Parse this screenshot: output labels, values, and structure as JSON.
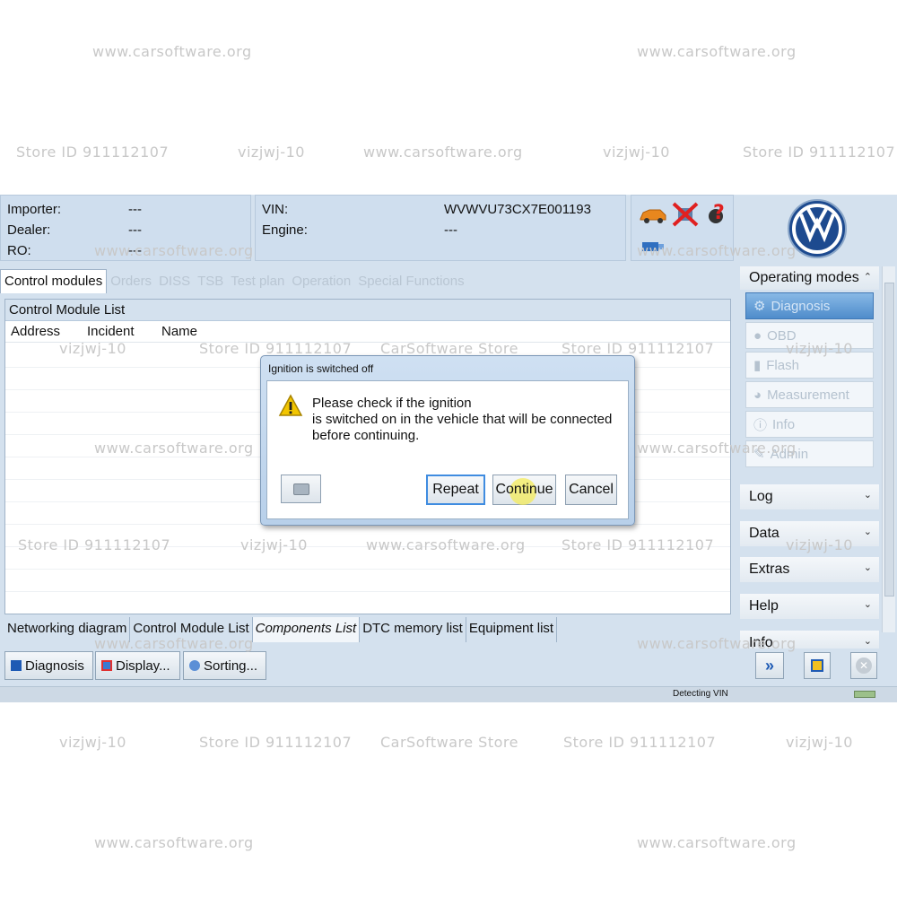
{
  "watermarks": {
    "site": "www.carsoftware.org",
    "store_id": "Store ID 911112107",
    "user": "vizjwj-10",
    "store": "CarSoftware Store"
  },
  "header": {
    "importer_label": "Importer:",
    "importer_value": "---",
    "dealer_label": "Dealer:",
    "dealer_value": "---",
    "ro_label": "RO:",
    "ro_value": "---",
    "vin_label": "VIN:",
    "vin_value": "WVWVU73CX7E001193",
    "engine_label": "Engine:",
    "engine_value": "---"
  },
  "tabs": [
    {
      "label": "Control modules",
      "active": true
    },
    {
      "label": "Orders"
    },
    {
      "label": "DISS"
    },
    {
      "label": "TSB"
    },
    {
      "label": "Test plan"
    },
    {
      "label": "Operation"
    },
    {
      "label": "Special Functions"
    }
  ],
  "control_module_list": {
    "title": "Control Module List",
    "columns": [
      "Address",
      "Incident",
      "Name"
    ]
  },
  "bottom_tabs": [
    {
      "label": "Networking diagram"
    },
    {
      "label": "Control Module List"
    },
    {
      "label": "Components List",
      "active": true
    },
    {
      "label": "DTC memory list"
    },
    {
      "label": "Equipment list"
    }
  ],
  "toolbar": {
    "diagnosis_label": "Diagnosis",
    "display_label": "Display...",
    "sorting_label": "Sorting..."
  },
  "status": {
    "text": "Detecting VIN"
  },
  "right_panel": {
    "operating_modes_label": "Operating modes",
    "items": [
      {
        "label": "Diagnosis",
        "icon": "diagnosis-icon",
        "selected": true
      },
      {
        "label": "OBD",
        "icon": "obd-icon"
      },
      {
        "label": "Flash",
        "icon": "flash-icon"
      },
      {
        "label": "Measurement",
        "icon": "measurement-icon"
      },
      {
        "label": "Info",
        "icon": "info-icon"
      },
      {
        "label": "Admin",
        "icon": "admin-icon"
      }
    ],
    "sections": [
      "Log",
      "Data",
      "Extras",
      "Help",
      "Info"
    ]
  },
  "dialog": {
    "title": "Ignition is switched off",
    "message_line1": "Please check if the ignition",
    "message_line2": "is switched on in the vehicle that will be connected",
    "message_line3": "before continuing.",
    "repeat_label": "Repeat",
    "continue_label": "Continue",
    "cancel_label": "Cancel"
  },
  "colors": {
    "app_background": "#d4e1ee",
    "selected_mode": "#4f8ccb",
    "vw_blue": "#1d4a8f",
    "warning_yellow": "#f2c500"
  }
}
